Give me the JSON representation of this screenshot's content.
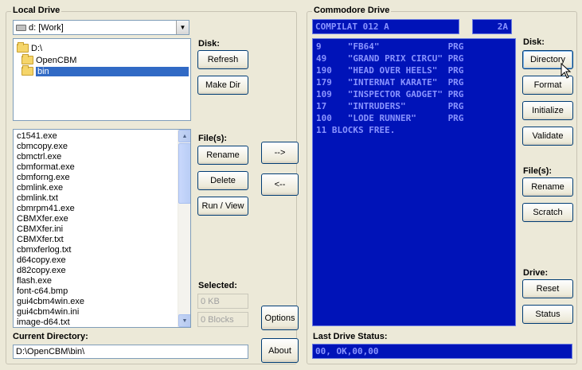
{
  "local": {
    "title": "Local Drive",
    "drive_select": "d: [Work]",
    "tree": [
      {
        "label": "D:\\",
        "selected": false
      },
      {
        "label": "OpenCBM",
        "selected": false
      },
      {
        "label": "bin",
        "selected": true
      }
    ],
    "files": [
      "c1541.exe",
      "cbmcopy.exe",
      "cbmctrl.exe",
      "cbmformat.exe",
      "cbmforng.exe",
      "cbmlink.exe",
      "cbmlink.txt",
      "cbmrpm41.exe",
      "CBMXfer.exe",
      "CBMXfer.ini",
      "CBMXfer.txt",
      "cbmxferlog.txt",
      "d64copy.exe",
      "d82copy.exe",
      "flash.exe",
      "font-c64.bmp",
      "gui4cbm4win.exe",
      "gui4cbm4win.ini",
      "image-d64.txt"
    ],
    "current_dir_label": "Current Directory:",
    "current_dir": "D:\\OpenCBM\\bin\\",
    "disk_label": "Disk:",
    "refresh": "Refresh",
    "make_dir": "Make Dir",
    "files_label": "File(s):",
    "rename": "Rename",
    "delete": "Delete",
    "run_view": "Run / View",
    "selected_label": "Selected:",
    "selected_kb_placeholder": "0 KB",
    "selected_blocks_placeholder": "0 Blocks"
  },
  "transfer": {
    "to_remote": "-->",
    "to_local": "<--",
    "options": "Options",
    "about": "About"
  },
  "commodore": {
    "title": "Commodore Drive",
    "disk_name": "COMPILAT 012 A",
    "disk_id": "2A",
    "listing": [
      "9     \"FB64\"             PRG",
      "49    \"GRAND PRIX CIRCU\" PRG",
      "190   \"HEAD OVER HEELS\"  PRG",
      "179   \"INTERNAT KARATE\"  PRG",
      "109   \"INSPECTOR GADGET\" PRG",
      "17    \"INTRUDERS\"        PRG",
      "100   \"LODE RUNNER\"      PRG",
      "11 BLOCKS FREE."
    ],
    "disk_label": "Disk:",
    "directory": "Directory",
    "format": "Format",
    "initialize": "Initialize",
    "validate": "Validate",
    "files_label": "File(s):",
    "rename": "Rename",
    "scratch": "Scratch",
    "drive_label": "Drive:",
    "reset": "Reset",
    "status": "Status",
    "last_status_label": "Last Drive Status:",
    "last_status": "00, OK,00,00"
  },
  "colors": {
    "c64_bg": "#0013b8",
    "c64_fg": "#8a94ff",
    "window_bg": "#ece9d8",
    "selection": "#316ac5"
  }
}
